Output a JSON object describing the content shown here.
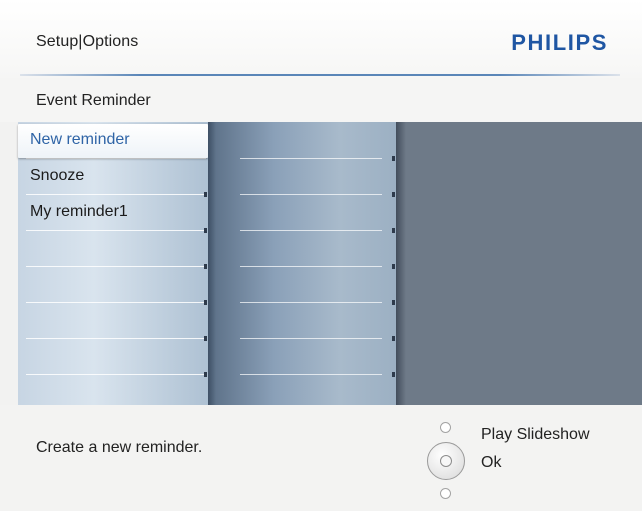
{
  "header": {
    "breadcrumb": "Setup|Options",
    "brand": "PHILIPS",
    "brand_color": "#1f56a3"
  },
  "subheader": {
    "title": "Event Reminder"
  },
  "menu": {
    "selected_index": 0,
    "items": [
      {
        "label": "New reminder"
      },
      {
        "label": "Snooze"
      },
      {
        "label": "My reminder1"
      }
    ]
  },
  "footer": {
    "hint": "Create  a new reminder.",
    "actions": {
      "up": "Play Slideshow",
      "center": "Ok"
    }
  },
  "icons": {
    "nav_up": "circle-outline-icon",
    "nav_center": "navigation-wheel-icon",
    "nav_down": "circle-outline-icon"
  }
}
